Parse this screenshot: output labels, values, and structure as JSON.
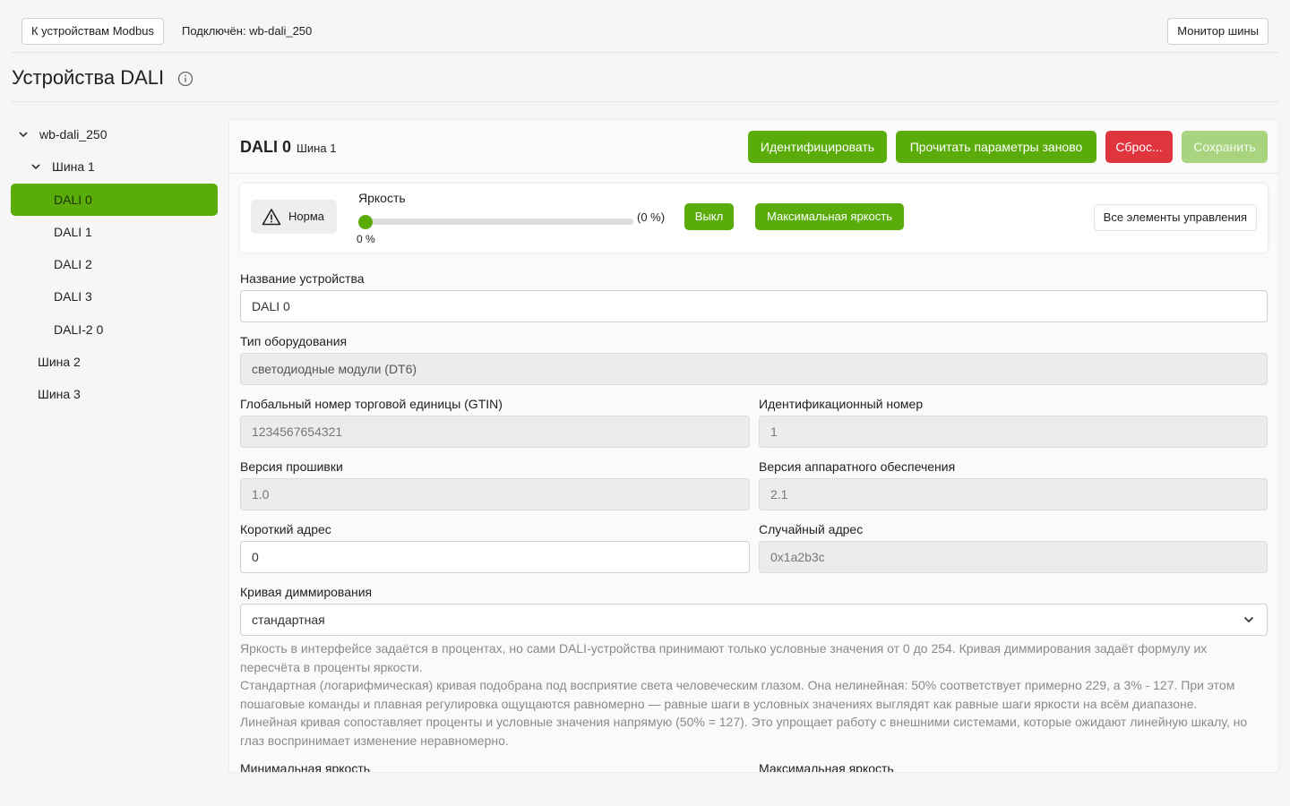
{
  "topbar": {
    "back_label": "К устройствам Modbus",
    "connected_label": "Подключён: wb-dali_250",
    "monitor_label": "Монитор шины"
  },
  "page": {
    "title": "Устройства DALI"
  },
  "tree": {
    "root": "wb-dali_250",
    "bus1": "Шина 1",
    "devices": [
      "DALI 0",
      "DALI 1",
      "DALI 2",
      "DALI 3",
      "DALI-2 0"
    ],
    "bus2": "Шина 2",
    "bus3": "Шина 3"
  },
  "device": {
    "title": "DALI 0",
    "bus": "Шина 1",
    "buttons": {
      "identify": "Идентифицировать",
      "reread": "Прочитать параметры заново",
      "reset": "Сброс...",
      "save": "Сохранить"
    }
  },
  "control": {
    "status": "Норма",
    "brightness_label": "Яркость",
    "brightness_value": "(0 %)",
    "brightness_value_below": "0 %",
    "brightness_level": 0,
    "off_label": "Выкл",
    "max_label": "Максимальная яркость",
    "all_controls_label": "Все элементы управления"
  },
  "form": {
    "name_label": "Название устройства",
    "name_value": "DALI 0",
    "type_label": "Тип оборудования",
    "type_value": "светодиодные модули (DT6)",
    "gtin_label": "Глобальный номер торговой единицы (GTIN)",
    "gtin_value": "1234567654321",
    "id_label": "Идентификационный номер",
    "id_value": "1",
    "fw_label": "Версия прошивки",
    "fw_value": "1.0",
    "hw_label": "Версия аппаратного обеспечения",
    "hw_value": "2.1",
    "short_label": "Короткий адрес",
    "short_value": "0",
    "random_label": "Случайный адрес",
    "random_value": "0x1a2b3c",
    "curve_label": "Кривая диммирования",
    "curve_value": "стандартная",
    "help_1": "Яркость в интерфейсе задаётся в процентах, но сами DALI-устройства принимают только условные значения от 0 до 254. Кривая диммирования задаёт формулу их пересчёта в проценты яркости.",
    "help_2": "Стандартная (логарифмическая) кривая подобрана под восприятие света человеческим глазом. Она нелинейная: 50% соответствует примерно 229, а 3% - 127. При этом пошаговые команды и плавная регулировка ощущаются равномерно — равные шаги в условных значениях выглядят как равные шаги яркости на всём диапазоне.",
    "help_3": "Линейная кривая сопоставляет проценты и условные значения напрямую (50% = 127). Это упрощает работу с внешними системами, которые ожидают линейную шкалу, но глаз воспринимает изменение неравномерно.",
    "min_label": "Минимальная яркость",
    "max_label": "Максимальная яркость"
  },
  "colors": {
    "accent": "#5aac0a",
    "danger": "#e0343f",
    "accent_disabled": "#a8d47f"
  },
  "icons": [
    "info-icon",
    "chevron-down-icon",
    "warning-icon"
  ]
}
